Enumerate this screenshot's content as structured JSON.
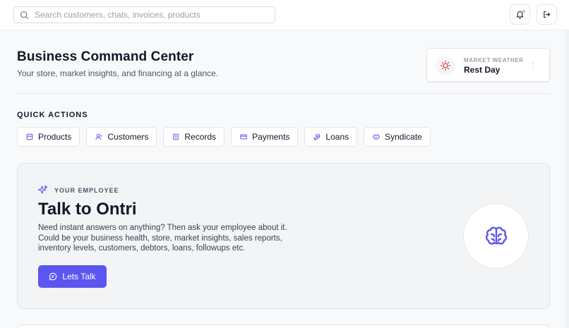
{
  "search": {
    "placeholder": "Search customers, chats, invoices, products"
  },
  "header": {
    "title": "Business Command Center",
    "subtitle": "Your store, market insights, and financing at a glance."
  },
  "weather": {
    "label": "MARKET WEATHER",
    "value": "Rest Day",
    "icon": "sun-icon"
  },
  "quick_actions": {
    "title": "QUICK ACTIONS",
    "items": [
      {
        "label": "Products",
        "icon": "box-icon"
      },
      {
        "label": "Customers",
        "icon": "users-icon"
      },
      {
        "label": "Records",
        "icon": "book-icon"
      },
      {
        "label": "Payments",
        "icon": "card-icon"
      },
      {
        "label": "Loans",
        "icon": "coins-icon"
      },
      {
        "label": "Syndicate",
        "icon": "handshake-icon"
      }
    ]
  },
  "employee": {
    "label": "YOUR EMPLOYEE",
    "title": "Talk to Ontri",
    "description": "Need instant answers on anything? Then ask your employee about it. Could be your business health, store, market insights, sales reports, inventory levels, customers, debtors, loans, followups etc.",
    "button_label": "Lets Talk"
  },
  "colors": {
    "accent": "#5b56f0",
    "weather_icon": "#e0454b"
  }
}
